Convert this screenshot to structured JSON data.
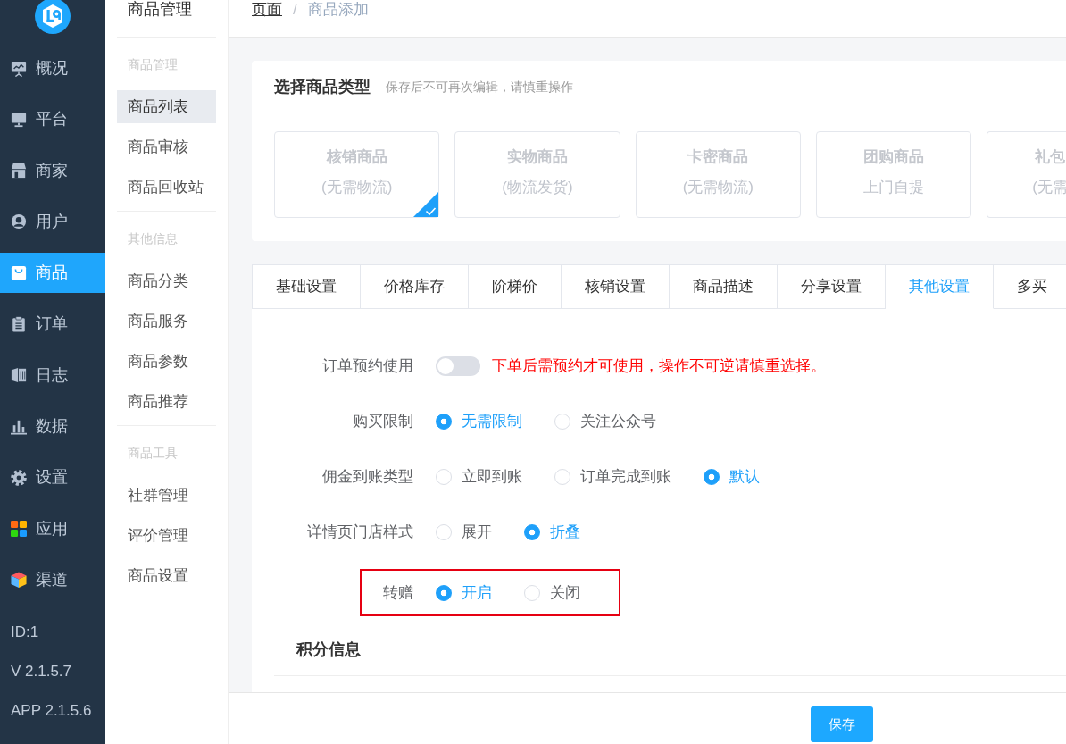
{
  "sidebar": {
    "items": [
      {
        "label": "概况",
        "selected": false
      },
      {
        "label": "平台",
        "selected": false
      },
      {
        "label": "商家",
        "selected": false
      },
      {
        "label": "用户",
        "selected": false
      },
      {
        "label": "商品",
        "selected": true
      },
      {
        "label": "订单",
        "selected": false
      },
      {
        "label": "日志",
        "selected": false
      },
      {
        "label": "数据",
        "selected": false
      },
      {
        "label": "设置",
        "selected": false
      },
      {
        "label": "应用",
        "selected": false
      },
      {
        "label": "渠道",
        "selected": false
      }
    ],
    "footer": [
      "ID:1",
      "V 2.1.5.7",
      "APP 2.1.5.6"
    ]
  },
  "submenu": {
    "title": "商品管理",
    "groups": [
      {
        "heading": "商品管理",
        "items": [
          {
            "label": "商品列表",
            "selected": true
          },
          {
            "label": "商品审核",
            "selected": false
          },
          {
            "label": "商品回收站",
            "selected": false
          }
        ]
      },
      {
        "heading": "其他信息",
        "items": [
          {
            "label": "商品分类",
            "selected": false
          },
          {
            "label": "商品服务",
            "selected": false
          },
          {
            "label": "商品参数",
            "selected": false
          },
          {
            "label": "商品推荐",
            "selected": false
          }
        ]
      },
      {
        "heading": "商品工具",
        "items": [
          {
            "label": "社群管理",
            "selected": false
          },
          {
            "label": "评价管理",
            "selected": false
          },
          {
            "label": "商品设置",
            "selected": false
          }
        ]
      }
    ]
  },
  "breadcrumb": {
    "items": [
      "页面",
      "商品添加"
    ],
    "separator": "/"
  },
  "type_selector": {
    "title": "选择商品类型",
    "hint": "保存后不可再次编辑，请慎重操作",
    "types": [
      {
        "name": "核销商品",
        "note": "(无需物流)",
        "selected": true
      },
      {
        "name": "实物商品",
        "note": "(物流发货)",
        "selected": false
      },
      {
        "name": "卡密商品",
        "note": "(无需物流)",
        "selected": false
      },
      {
        "name": "团购商品",
        "note": "上门自提",
        "selected": false
      },
      {
        "name": "礼包",
        "note": "(无需",
        "selected": false
      }
    ]
  },
  "tabs": [
    {
      "label": "基础设置",
      "selected": false
    },
    {
      "label": "价格库存",
      "selected": false
    },
    {
      "label": "阶梯价",
      "selected": false
    },
    {
      "label": "核销设置",
      "selected": false
    },
    {
      "label": "商品描述",
      "selected": false
    },
    {
      "label": "分享设置",
      "selected": false
    },
    {
      "label": "其他设置",
      "selected": true
    },
    {
      "label": "多买",
      "selected": false
    }
  ],
  "form": {
    "rows": [
      {
        "kind": "switch",
        "label": "订单预约使用",
        "on": false,
        "note": "下单后需预约才可使用，操作不可逆请慎重选择。",
        "highlighted": false
      },
      {
        "kind": "radio",
        "label": "购买限制",
        "highlighted": false,
        "options": [
          {
            "label": "无需限制",
            "selected": true
          },
          {
            "label": "关注公众号",
            "selected": false
          }
        ]
      },
      {
        "kind": "radio",
        "label": "佣金到账类型",
        "highlighted": false,
        "options": [
          {
            "label": "立即到账",
            "selected": false
          },
          {
            "label": "订单完成到账",
            "selected": false
          },
          {
            "label": "默认",
            "selected": true
          }
        ]
      },
      {
        "kind": "radio",
        "label": "详情页门店样式",
        "highlighted": false,
        "options": [
          {
            "label": "展开",
            "selected": false
          },
          {
            "label": "折叠",
            "selected": true
          }
        ]
      },
      {
        "kind": "radio",
        "label": "转赠",
        "highlighted": true,
        "options": [
          {
            "label": "开启",
            "selected": true
          },
          {
            "label": "关闭",
            "selected": false
          }
        ]
      }
    ]
  },
  "section_title": "积分信息",
  "save_button": "保存"
}
